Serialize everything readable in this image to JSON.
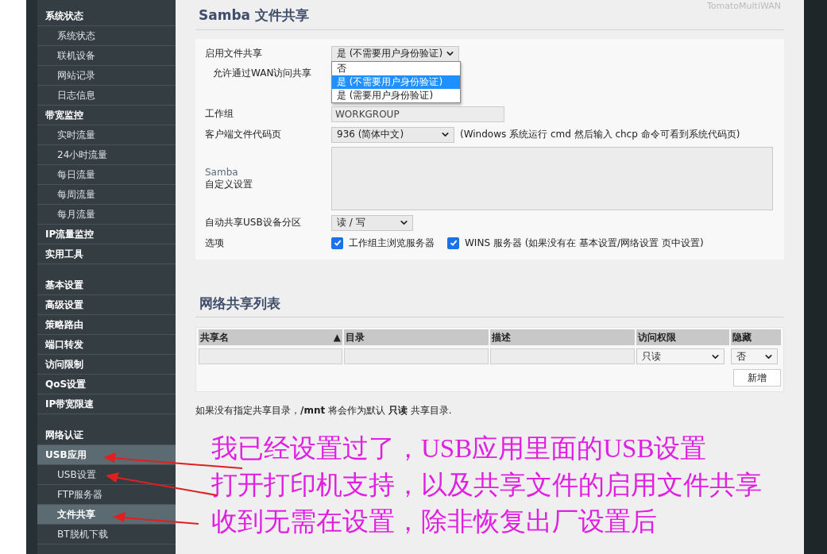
{
  "sidebar": {
    "groups": [
      {
        "items": [
          {
            "label": "系统状态",
            "selected": false,
            "children": [
              {
                "label": "系统状态",
                "selected": false
              },
              {
                "label": "联机设备",
                "selected": false
              },
              {
                "label": "网站记录",
                "selected": false
              },
              {
                "label": "日志信息",
                "selected": false
              }
            ]
          },
          {
            "label": "带宽监控",
            "selected": false,
            "children": [
              {
                "label": "实时流量",
                "selected": false
              },
              {
                "label": "24小时流量",
                "selected": false
              },
              {
                "label": "每日流量",
                "selected": false
              },
              {
                "label": "每周流量",
                "selected": false
              },
              {
                "label": "每月流量",
                "selected": false
              }
            ]
          },
          {
            "label": "IP流量监控",
            "selected": false
          },
          {
            "label": "实用工具",
            "selected": false
          }
        ]
      },
      {
        "items": [
          {
            "label": "基本设置",
            "selected": false
          },
          {
            "label": "高级设置",
            "selected": false
          },
          {
            "label": "策略路由",
            "selected": false
          },
          {
            "label": "端口转发",
            "selected": false
          },
          {
            "label": "访问限制",
            "selected": false
          },
          {
            "label": "QoS设置",
            "selected": false
          },
          {
            "label": "IP带宽限速",
            "selected": false
          }
        ]
      },
      {
        "items": [
          {
            "label": "网络认证",
            "selected": false
          },
          {
            "label": "USB应用",
            "selected": true,
            "children": [
              {
                "label": "USB设置",
                "selected": false
              },
              {
                "label": "FTP服务器",
                "selected": false
              },
              {
                "label": "文件共享",
                "selected": true
              },
              {
                "label": "BT脱机下载",
                "selected": false
              }
            ]
          }
        ]
      }
    ]
  },
  "header": {
    "title": "Samba 文件共享",
    "brand": "TomatoMultiWAN"
  },
  "settings": {
    "rows": [
      {
        "kind": "select",
        "label": "启用文件共享",
        "value": "是 (不需要用户身份验证)",
        "expanded": true,
        "options": [
          {
            "label": "否",
            "selected": false
          },
          {
            "label": "是 (不需要用户身份验证)",
            "selected": true
          },
          {
            "label": "是 (需要用户身份验证)",
            "selected": false
          }
        ]
      },
      {
        "kind": "label",
        "label": "允许通过WAN访问共享"
      },
      {
        "kind": "input",
        "label": "工作组",
        "value": "WORKGROUP",
        "disabled": true
      },
      {
        "kind": "select",
        "label": "客户端文件代码页",
        "value": "936 (简体中文)",
        "hint": "(Windows 系统运行 cmd 然后输入 chcp 命令可看到系统代码页)"
      },
      {
        "kind": "textarea",
        "label_lines": [
          "Samba",
          "自定义设置"
        ]
      },
      {
        "kind": "select",
        "label": "自动共享USB设备分区",
        "value": "读 / 写"
      },
      {
        "kind": "checkboxes",
        "label": "选项",
        "options": [
          {
            "label": "工作组主浏览服务器",
            "checked": true
          },
          {
            "label": "WINS 服务器 (如果没有在 基本设置/网络设置 页中设置)",
            "checked": true
          }
        ]
      }
    ]
  },
  "share_list": {
    "title": "网络共享列表",
    "columns": [
      {
        "label": "共享名",
        "sort_indicator": "▲"
      },
      {
        "label": "目录"
      },
      {
        "label": "描述"
      },
      {
        "label": "访问权限"
      },
      {
        "label": "隐藏"
      }
    ],
    "new_row": {
      "access": "只读",
      "hidden": "否"
    },
    "add_button": "新增"
  },
  "note": "如果没有指定共享目录，**/mnt** 将会作为默认 **只读** 共享目录.",
  "annotation": {
    "lines": [
      "我已经设置过了，USB应用里面的USB设置",
      "打开打印机支持，以及共享文件的启用文件共享",
      "收到无需在设置，除非恢复出厂设置后"
    ]
  }
}
